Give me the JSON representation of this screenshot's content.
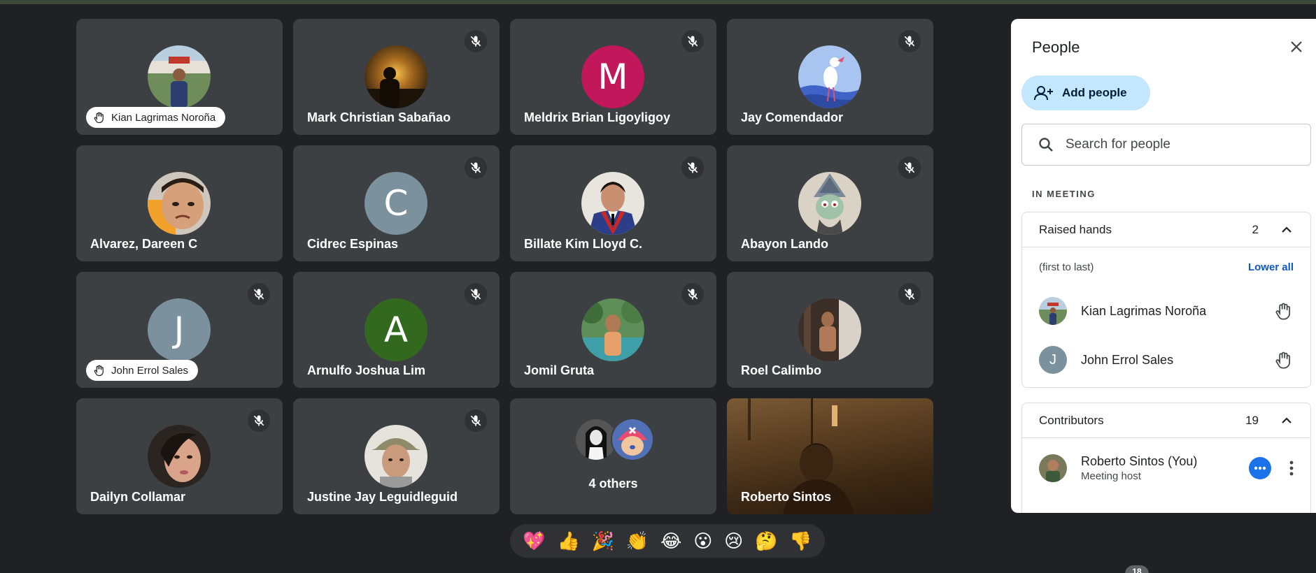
{
  "tiles": [
    {
      "name": "Kian Lagrimas Noroña",
      "hand_raised": true,
      "muted": false
    },
    {
      "name": "Mark Christian Sabañao",
      "hand_raised": false,
      "muted": true
    },
    {
      "name": "Meldrix Brian Ligoyligoy",
      "hand_raised": false,
      "muted": true,
      "initial": "M"
    },
    {
      "name": "Jay Comendador",
      "hand_raised": false,
      "muted": true
    },
    {
      "name": "Alvarez, Dareen C",
      "hand_raised": false,
      "muted": false
    },
    {
      "name": "Cidrec Espinas",
      "hand_raised": false,
      "muted": true,
      "initial": "C"
    },
    {
      "name": "Billate Kim Lloyd C.",
      "hand_raised": false,
      "muted": true
    },
    {
      "name": "Abayon Lando",
      "hand_raised": false,
      "muted": true
    },
    {
      "name": "John Errol Sales",
      "hand_raised": true,
      "muted": true,
      "initial": "J"
    },
    {
      "name": "Arnulfo Joshua Lim",
      "hand_raised": false,
      "muted": true,
      "initial": "A"
    },
    {
      "name": "Jomil Gruta",
      "hand_raised": false,
      "muted": true
    },
    {
      "name": "Roel Calimbo",
      "hand_raised": false,
      "muted": true
    },
    {
      "name": "Dailyn Collamar",
      "hand_raised": false,
      "muted": true
    },
    {
      "name": "Justine Jay Leguidleguid",
      "hand_raised": false,
      "muted": true
    }
  ],
  "others_tile": {
    "label": "4 others"
  },
  "self_tile": {
    "name": "Roberto Sintos"
  },
  "reactions": [
    "💖",
    "👍",
    "🎉",
    "👏",
    "😂",
    "😮",
    "😢",
    "🤔",
    "👎"
  ],
  "bottom_badge": "18",
  "panel": {
    "title": "People",
    "add_people_label": "Add people",
    "search_placeholder": "Search for people",
    "section_label": "IN MEETING",
    "raised_hands": {
      "title": "Raised hands",
      "count": "2",
      "order_note": "(first to last)",
      "lower_all_label": "Lower all",
      "people": [
        {
          "name": "Kian Lagrimas Noroña"
        },
        {
          "name": "John Errol Sales",
          "initial": "J"
        }
      ]
    },
    "contributors": {
      "title": "Contributors",
      "count": "19",
      "people": [
        {
          "name": "Roberto Sintos (You)",
          "role": "Meeting host"
        }
      ]
    }
  },
  "colors": {
    "background": "#202124",
    "tile": "#3c4043",
    "avatar_meldrix": "#c2185b",
    "avatar_gray": "#7b929e",
    "avatar_arnulfo": "#33691e",
    "panel_accent": "#c2e7ff",
    "link_blue": "#0b57d0"
  }
}
